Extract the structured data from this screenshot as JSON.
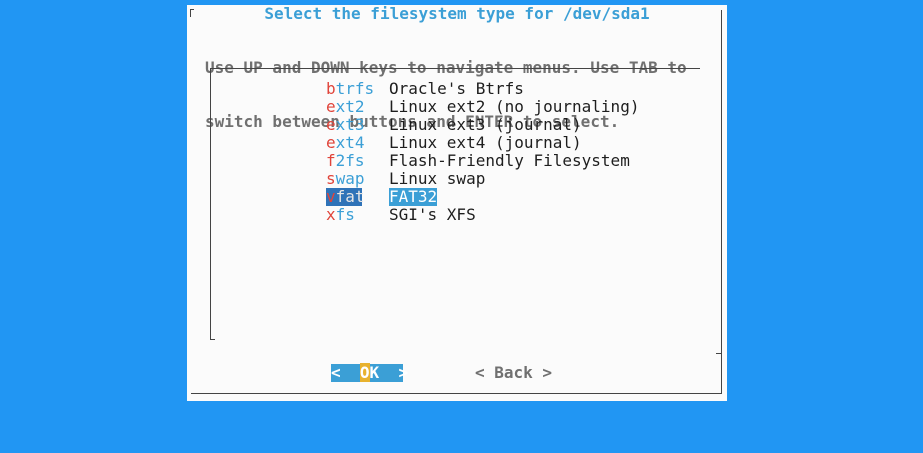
{
  "dialog": {
    "title": "Select the filesystem type for /dev/sda1",
    "help_line1": "Use UP and DOWN keys to navigate menus. Use TAB to",
    "help_line2": "switch between buttons and ENTER to select."
  },
  "menu": {
    "items": [
      {
        "tag_hot": "b",
        "tag_rest": "trfs",
        "desc": "Oracle's Btrfs"
      },
      {
        "tag_hot": "e",
        "tag_rest": "xt2",
        "desc": "Linux ext2 (no journaling)"
      },
      {
        "tag_hot": "e",
        "tag_rest": "xt3",
        "desc": "Linux ext3 (journal)"
      },
      {
        "tag_hot": "e",
        "tag_rest": "xt4",
        "desc": "Linux ext4 (journal)"
      },
      {
        "tag_hot": "f",
        "tag_rest": "2fs",
        "desc": "Flash-Friendly Filesystem"
      },
      {
        "tag_hot": "s",
        "tag_rest": "wap",
        "desc": "Linux swap"
      },
      {
        "tag_hot": "v",
        "tag_rest": "fat",
        "desc": "FAT32"
      },
      {
        "tag_hot": "x",
        "tag_rest": "fs",
        "desc": "SGI's XFS"
      }
    ],
    "selected_index": 6
  },
  "buttons": {
    "ok_left": "<  ",
    "ok_hot": "O",
    "ok_rest": "K  >",
    "back": "< Back >"
  },
  "colors": {
    "background": "#2196f3",
    "accent": "#3b9fd6",
    "hotkey": "#e0443a"
  }
}
